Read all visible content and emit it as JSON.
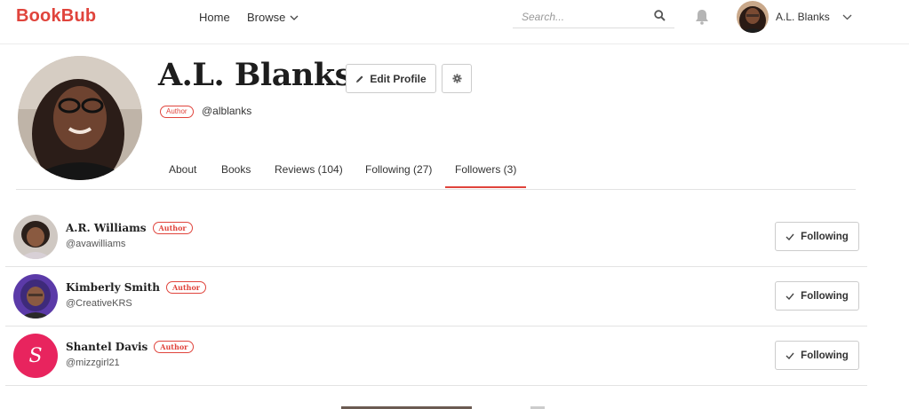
{
  "header": {
    "logo": "BookBub",
    "nav_home": "Home",
    "nav_browse": "Browse",
    "search_placeholder": "Search...",
    "user_name": "A.L. Blanks"
  },
  "profile": {
    "name": "A.L. Blanks",
    "edit_label": "Edit Profile",
    "badge": "Author",
    "handle": "@alblanks"
  },
  "tabs": [
    {
      "label": "About"
    },
    {
      "label": "Books"
    },
    {
      "label": "Reviews (104)"
    },
    {
      "label": "Following (27)"
    },
    {
      "label": "Followers (3)",
      "active": true
    }
  ],
  "followers": [
    {
      "name": "A.R. Williams",
      "badge": "Author",
      "handle": "@avawilliams",
      "button": "Following"
    },
    {
      "name": "Kimberly Smith",
      "badge": "Author",
      "handle": "@CreativeKRS",
      "button": "Following"
    },
    {
      "name": "Shantel Davis",
      "badge": "Author",
      "handle": "@mizzgirl21",
      "button": "Following",
      "initial": "S"
    }
  ],
  "colors": {
    "brand": "#e0443c",
    "avatar_pink": "#e8245e"
  }
}
